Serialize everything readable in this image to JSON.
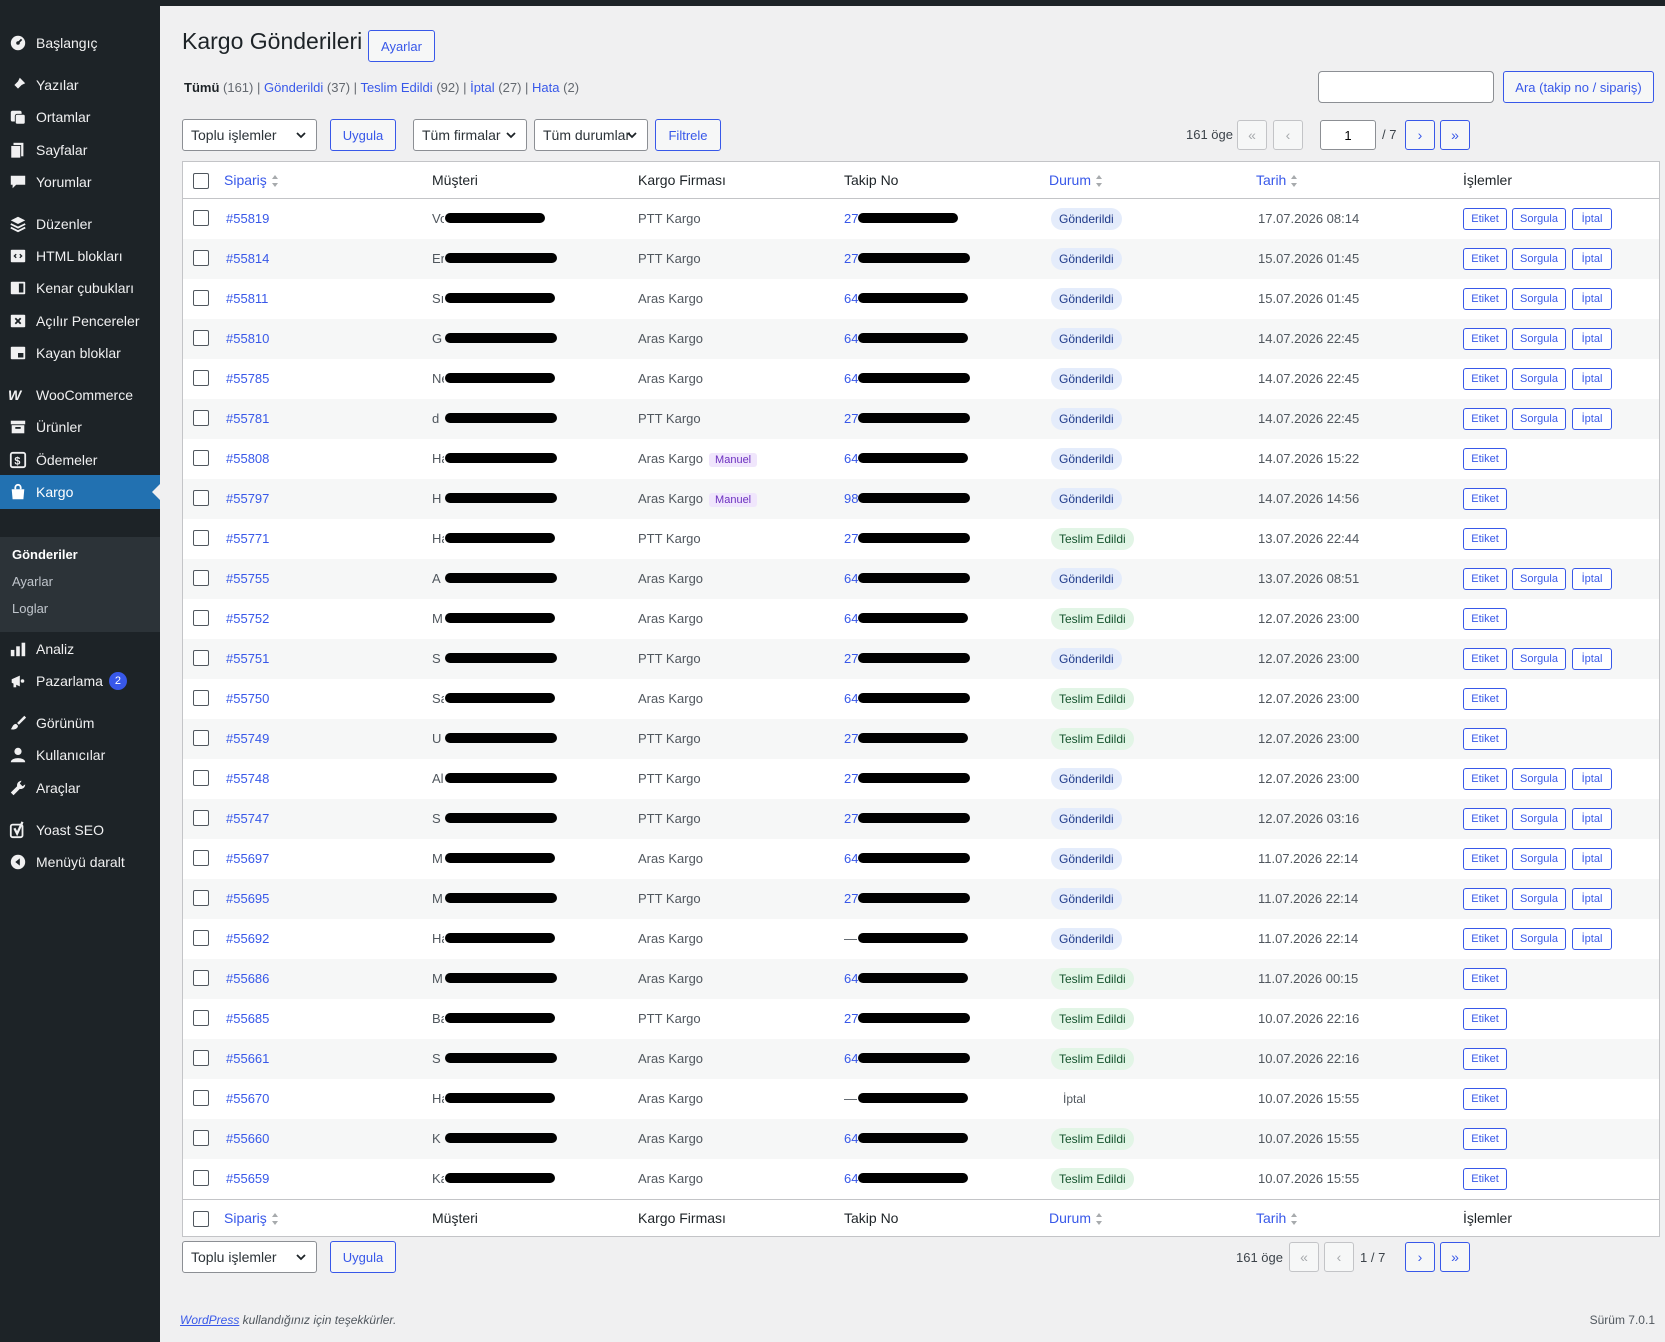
{
  "sidebar": {
    "items": [
      {
        "label": "Başlangıç",
        "icon": "dashboard-icon"
      },
      {
        "label": "Yazılar",
        "icon": "pin-icon"
      },
      {
        "label": "Ortamlar",
        "icon": "media-icon"
      },
      {
        "label": "Sayfalar",
        "icon": "pages-icon"
      },
      {
        "label": "Yorumlar",
        "icon": "comment-icon"
      },
      {
        "label": "Düzenler",
        "icon": "layers-icon"
      },
      {
        "label": "HTML blokları",
        "icon": "html-icon"
      },
      {
        "label": "Kenar çubukları",
        "icon": "sidebar-icon"
      },
      {
        "label": "Açılır Pencereler",
        "icon": "popup-icon"
      },
      {
        "label": "Kayan bloklar",
        "icon": "floating-icon"
      },
      {
        "label": "WooCommerce",
        "icon": "woo-icon"
      },
      {
        "label": "Ürünler",
        "icon": "archive-icon"
      },
      {
        "label": "Ödemeler",
        "icon": "dollar-icon"
      },
      {
        "label": "Kargo",
        "icon": "bag-icon"
      },
      {
        "label": "Analiz",
        "icon": "chart-icon"
      },
      {
        "label": "Pazarlama",
        "icon": "megaphone-icon",
        "badge": "2"
      },
      {
        "label": "Görünüm",
        "icon": "brush-icon"
      },
      {
        "label": "Kullanıcılar",
        "icon": "user-icon"
      },
      {
        "label": "Araçlar",
        "icon": "wrench-icon"
      },
      {
        "label": "Yoast SEO",
        "icon": "yoast-icon"
      },
      {
        "label": "Menüyü daralt",
        "icon": "collapse-icon"
      }
    ],
    "submenu": [
      "Gönderiler",
      "Ayarlar",
      "Loglar"
    ]
  },
  "page": {
    "title": "Kargo Gönderileri",
    "settings_button": "Ayarlar"
  },
  "filters": {
    "all": "Tümü",
    "all_count": "(161)",
    "sent": "Gönderildi",
    "sent_count": "(37)",
    "delivered": "Teslim Edildi",
    "delivered_count": "(92)",
    "cancelled": "İptal",
    "cancelled_count": "(27)",
    "error": "Hata",
    "error_count": "(2)",
    "sep": "|"
  },
  "toolbar": {
    "bulk": "Toplu işlemler",
    "apply": "Uygula",
    "firms": "Tüm firmalar",
    "statuses": "Tüm durumlar",
    "filter": "Filtrele",
    "search_button": "Ara (takip no / sipariş)",
    "search_value": "",
    "items": "161 öge",
    "page_current": "1",
    "page_total": "/ 7",
    "page_display": "1 / 7",
    "first": "«",
    "prev": "‹",
    "next": "›",
    "last": "»"
  },
  "table": {
    "columns": [
      "Sipariş",
      "Müşteri",
      "Kargo Firması",
      "Takip No",
      "Durum",
      "Tarih",
      "İşlemler"
    ],
    "actions": {
      "label": "Etiket",
      "query": "Sorgula",
      "cancel": "İptal"
    },
    "manual_tag": "Manuel",
    "rows": [
      {
        "order": "#55819",
        "cust": "Vo",
        "firm": "PTT Kargo",
        "track": "27",
        "status": "Gönderildi",
        "st": "sent",
        "date": "17.07.2026 08:14"
      },
      {
        "order": "#55814",
        "cust": "Er",
        "firm": "PTT Kargo",
        "track": "27",
        "status": "Gönderildi",
        "st": "sent",
        "date": "15.07.2026 01:45"
      },
      {
        "order": "#55811",
        "cust": "Sıl",
        "firm": "Aras Kargo",
        "track": "64",
        "status": "Gönderildi",
        "st": "sent",
        "date": "15.07.2026 01:45"
      },
      {
        "order": "#55810",
        "cust": "G",
        "firm": "Aras Kargo",
        "track": "64",
        "status": "Gönderildi",
        "st": "sent",
        "date": "14.07.2026 22:45"
      },
      {
        "order": "#55785",
        "cust": "Ne",
        "firm": "Aras Kargo",
        "track": "64",
        "status": "Gönderildi",
        "st": "sent",
        "date": "14.07.2026 22:45"
      },
      {
        "order": "#55781",
        "cust": "d",
        "firm": "PTT Kargo",
        "track": "27",
        "status": "Gönderildi",
        "st": "sent",
        "date": "14.07.2026 22:45"
      },
      {
        "order": "#55808",
        "cust": "Ha",
        "firm": "Aras Kargo",
        "manual": true,
        "track": "64",
        "status": "Gönderildi",
        "st": "sent",
        "date": "14.07.2026 15:22"
      },
      {
        "order": "#55797",
        "cust": "H",
        "firm": "Aras Kargo",
        "manual": true,
        "track": "98",
        "status": "Gönderildi",
        "st": "sent",
        "date": "14.07.2026 14:56"
      },
      {
        "order": "#55771",
        "cust": "Ha",
        "firm": "PTT Kargo",
        "track": "27",
        "status": "Teslim Edildi",
        "st": "delivered",
        "date": "13.07.2026 22:44"
      },
      {
        "order": "#55755",
        "cust": "A",
        "firm": "Aras Kargo",
        "track": "64",
        "status": "Gönderildi",
        "st": "sent",
        "date": "13.07.2026 08:51"
      },
      {
        "order": "#55752",
        "cust": "M",
        "firm": "Aras Kargo",
        "track": "64",
        "status": "Teslim Edildi",
        "st": "delivered",
        "date": "12.07.2026 23:00"
      },
      {
        "order": "#55751",
        "cust": "S",
        "firm": "PTT Kargo",
        "track": "27",
        "status": "Gönderildi",
        "st": "sent",
        "date": "12.07.2026 23:00"
      },
      {
        "order": "#55750",
        "cust": "Sa",
        "firm": "Aras Kargo",
        "track": "64",
        "status": "Teslim Edildi",
        "st": "delivered",
        "date": "12.07.2026 23:00"
      },
      {
        "order": "#55749",
        "cust": "U",
        "firm": "PTT Kargo",
        "track": "27",
        "status": "Teslim Edildi",
        "st": "delivered",
        "date": "12.07.2026 23:00"
      },
      {
        "order": "#55748",
        "cust": "Al",
        "firm": "PTT Kargo",
        "track": "27",
        "status": "Gönderildi",
        "st": "sent",
        "date": "12.07.2026 23:00"
      },
      {
        "order": "#55747",
        "cust": "S",
        "firm": "PTT Kargo",
        "track": "27",
        "status": "Gönderildi",
        "st": "sent",
        "date": "12.07.2026 03:16"
      },
      {
        "order": "#55697",
        "cust": "M",
        "firm": "Aras Kargo",
        "track": "64",
        "status": "Gönderildi",
        "st": "sent",
        "date": "11.07.2026 22:14"
      },
      {
        "order": "#55695",
        "cust": "M",
        "firm": "PTT Kargo",
        "track": "27",
        "status": "Gönderildi",
        "st": "sent",
        "date": "11.07.2026 22:14"
      },
      {
        "order": "#55692",
        "cust": "Ha",
        "firm": "Aras Kargo",
        "track": "—",
        "status": "Gönderildi",
        "st": "sent",
        "date": "11.07.2026 22:14"
      },
      {
        "order": "#55686",
        "cust": "M",
        "firm": "Aras Kargo",
        "track": "64",
        "status": "Teslim Edildi",
        "st": "delivered",
        "date": "11.07.2026 00:15"
      },
      {
        "order": "#55685",
        "cust": "Ba",
        "firm": "PTT Kargo",
        "track": "27",
        "status": "Teslim Edildi",
        "st": "delivered",
        "date": "10.07.2026 22:16"
      },
      {
        "order": "#55661",
        "cust": "S",
        "firm": "Aras Kargo",
        "track": "64",
        "status": "Teslim Edildi",
        "st": "delivered",
        "date": "10.07.2026 22:16"
      },
      {
        "order": "#55670",
        "cust": "Ha",
        "firm": "Aras Kargo",
        "track": "—",
        "status": "İptal",
        "st": "cancelled",
        "date": "10.07.2026 15:55"
      },
      {
        "order": "#55660",
        "cust": "K",
        "firm": "Aras Kargo",
        "track": "64",
        "status": "Teslim Edildi",
        "st": "delivered",
        "date": "10.07.2026 15:55"
      },
      {
        "order": "#55659",
        "cust": "Ka",
        "firm": "Aras Kargo",
        "track": "64",
        "status": "Teslim Edildi",
        "st": "delivered",
        "date": "10.07.2026 15:55"
      }
    ]
  },
  "footer": {
    "wp_link": "WordPress",
    "thanks": " kullandığınız için teşekkürler.",
    "version": "Sürüm 7.0.1"
  },
  "colors": {
    "accent": "#3858e9",
    "sidebar": "#1d2327",
    "active": "#2271b1"
  }
}
